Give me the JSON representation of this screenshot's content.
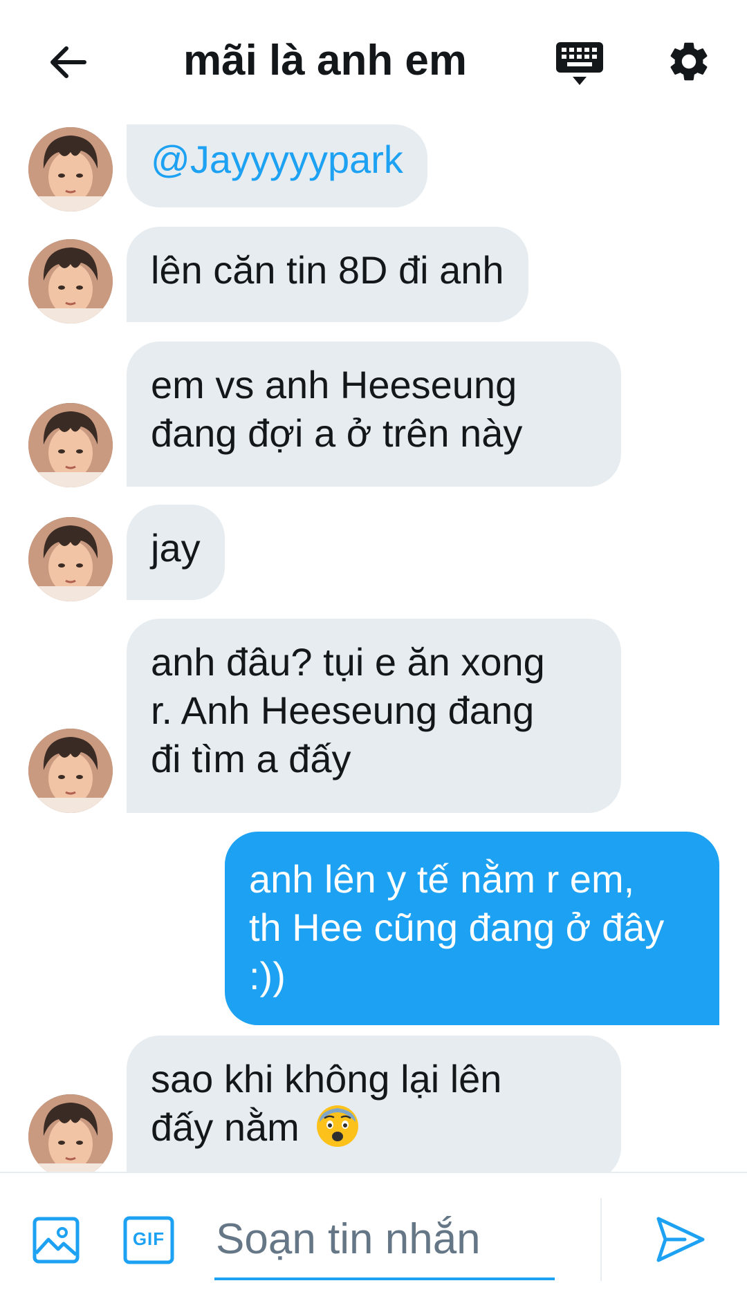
{
  "header": {
    "title": "mãi là anh em",
    "back_icon": "arrow-left-icon",
    "keyboard_icon": "keyboard-icon",
    "settings_icon": "gear-icon"
  },
  "messages": [
    {
      "direction": "in",
      "lines": [
        "@Jayyyyypark"
      ],
      "mention": true
    },
    {
      "direction": "in",
      "lines": [
        "lên căn tin 8D đi anh"
      ]
    },
    {
      "direction": "in",
      "lines": [
        "em vs anh Heeseung",
        "đang đợi a ở trên này"
      ]
    },
    {
      "direction": "in",
      "lines": [
        "jay"
      ]
    },
    {
      "direction": "in",
      "lines": [
        "anh đâu? tụi e ăn xong",
        "r. Anh Heeseung đang",
        "đi tìm a đấy"
      ]
    },
    {
      "direction": "out",
      "lines": [
        "anh lên y tế nằm r em,",
        "th Hee cũng đang ở đây",
        ":))"
      ]
    },
    {
      "direction": "in",
      "lines": [
        "sao khi không lại lên",
        "đấy nằm"
      ],
      "emoji": "anxious-face-emoji"
    }
  ],
  "composer": {
    "placeholder": "Soạn tin nhắn",
    "image_icon": "image-icon",
    "gif_label": "GIF",
    "send_icon": "send-icon"
  },
  "colors": {
    "accent": "#1da1f2",
    "bubble_in": "#e6ecf0",
    "text": "#14171a",
    "placeholder": "#657786"
  }
}
